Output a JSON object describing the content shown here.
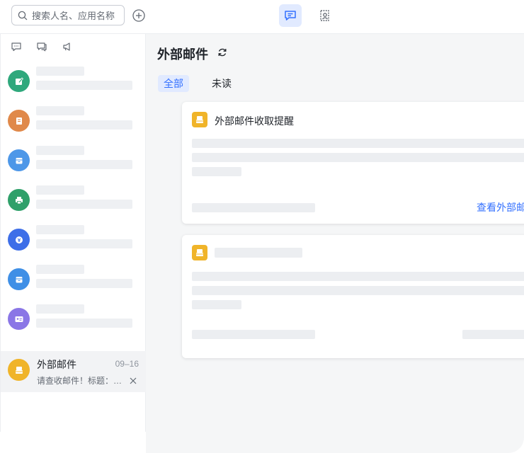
{
  "search": {
    "placeholder": "搜索人名、应用名称"
  },
  "main": {
    "title": "外部邮件",
    "tabs": [
      {
        "label": "全部"
      },
      {
        "label": "未读"
      }
    ]
  },
  "cards": [
    {
      "title": "外部邮件收取提醒",
      "link": "查看外部邮"
    },
    {
      "title": ""
    }
  ],
  "conversations": {
    "active": {
      "title": "外部邮件",
      "time": "09–16",
      "preview": "请查收邮件！标题：…"
    },
    "avatar_colors": [
      "#2fa87c",
      "#e0894a",
      "#4d97e8",
      "#2fa06a",
      "#3d6ee8",
      "#3f8fe6",
      "#8a76e6",
      "#f0b429"
    ]
  },
  "colors": {
    "accent": "#3370ff",
    "tab_active_bg": "#e1eaff"
  }
}
